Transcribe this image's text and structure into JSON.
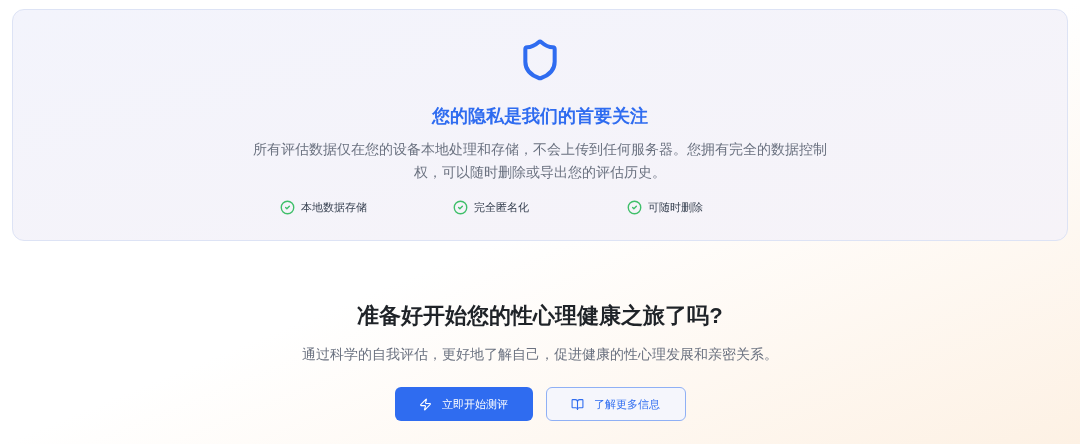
{
  "privacy": {
    "title": "您的隐私是我们的首要关注",
    "description": "所有评估数据仅在您的设备本地处理和存储，不会上传到任何服务器。您拥有完全的数据控制权，可以随时删除或导出您的评估历史。",
    "features": [
      "本地数据存储",
      "完全匿名化",
      "可随时删除"
    ]
  },
  "cta": {
    "title": "准备好开始您的性心理健康之旅了吗?",
    "subtitle": "通过科学的自我评估，更好地了解自己，促进健康的性心理发展和亲密关系。",
    "buttons": [
      {
        "kind": "primary",
        "label": "立即开始测评"
      },
      {
        "kind": "outline",
        "label": "了解更多信息"
      }
    ]
  }
}
